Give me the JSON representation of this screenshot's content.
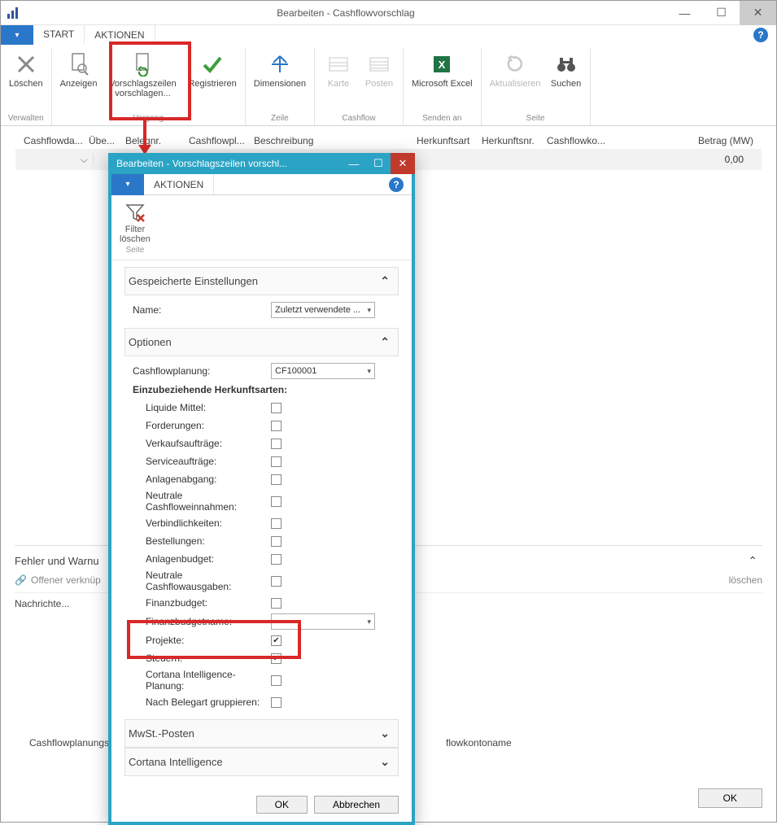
{
  "window": {
    "title": "Bearbeiten - Cashflowvorschlag",
    "app_icon": "chart-icon"
  },
  "tabs": {
    "file_arrow": "▾",
    "start": "START",
    "aktionen": "AKTIONEN"
  },
  "ribbon": {
    "verwalten": {
      "label": "Verwalten",
      "loeschen": "Löschen"
    },
    "vorgang": {
      "label": "Vorgang",
      "anzeigen": "Anzeigen",
      "vorschlag": "Vorschlagszeilen vorschlagen...",
      "registrieren": "Registrieren"
    },
    "zeile": {
      "label": "Zeile",
      "dimensionen": "Dimensionen"
    },
    "cashflow": {
      "label": "Cashflow",
      "karte": "Karte",
      "posten": "Posten"
    },
    "senden": {
      "label": "Senden an",
      "excel": "Microsoft Excel"
    },
    "seite": {
      "label": "Seite",
      "aktual": "Aktualisieren",
      "suchen": "Suchen"
    }
  },
  "grid": {
    "cols": {
      "cashflowda": "Cashflowda...",
      "uebe": "Übe...",
      "belegnr": "Belegnr.",
      "cashflowpl": "Cashflowpl...",
      "beschreibung": "Beschreibung",
      "herkunftsart": "Herkunftsart",
      "herkunftsnr": "Herkunftsnr.",
      "cashflowko": "Cashflowko...",
      "betrag": "Betrag (MW)"
    },
    "row1_amount": "0,00"
  },
  "errors": {
    "header": "Fehler und Warnu",
    "offener": "Offener verknüp",
    "loeschen": "löschen",
    "nachrichte": "Nachrichte..."
  },
  "bottom": {
    "planungsbe": "Cashflowplanungsbe",
    "kontoname": "flowkontoname",
    "ok": "OK"
  },
  "dialog": {
    "title": "Bearbeiten - Vorschlagszeilen vorschl...",
    "aktionen": "AKTIONEN",
    "filter_loeschen": "Filter löschen",
    "seite": "Seite",
    "sections": {
      "gespeichert": "Gespeicherte Einstellungen",
      "optionen": "Optionen",
      "mwst": "MwSt.-Posten",
      "cortana": "Cortana Intelligence"
    },
    "fields": {
      "name": "Name:",
      "name_value": "Zuletzt verwendete ...",
      "cashflowplanung": "Cashflowplanung:",
      "cashflowplanung_value": "CF100001",
      "einzubez": "Einzubeziehende Herkunftsarten:",
      "liquide": "Liquide Mittel:",
      "forderungen": "Forderungen:",
      "verkaufs": "Verkaufsaufträge:",
      "service": "Serviceaufträge:",
      "anlagenabgang": "Anlagenabgang:",
      "neutrale_ein": "Neutrale Cashfloweinnahmen:",
      "verbindlichkeiten": "Verbindlichkeiten:",
      "bestellungen": "Bestellungen:",
      "anlagenbudget": "Anlagenbudget:",
      "neutrale_aus": "Neutrale Cashflowausgaben:",
      "finanzbudget": "Finanzbudget:",
      "finanzbudgetname": "Finanzbudgetname:",
      "projekte": "Projekte:",
      "steuern": "Steuern:",
      "cortana_planung": "Cortana Intelligence-Planung:",
      "nach_belegart": "Nach Belegart gruppieren:"
    },
    "buttons": {
      "ok": "OK",
      "cancel": "Abbrechen"
    }
  }
}
